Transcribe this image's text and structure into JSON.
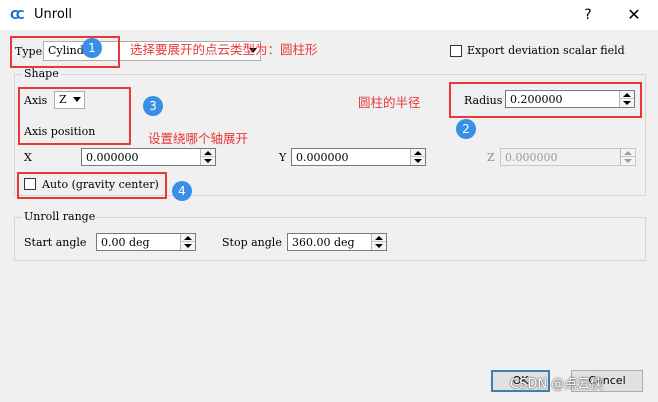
{
  "window": {
    "title": "Unroll",
    "help_glyph": "?",
    "close_glyph": "✕",
    "icon": "cloudcompare-logo-icon"
  },
  "type_row": {
    "label": "Type",
    "value": "Cylinder",
    "export_label": "Export deviation scalar field"
  },
  "shape": {
    "title": "Shape",
    "axis_label": "Axis",
    "axis_value": "Z",
    "axis_position_label": "Axis position",
    "radius_label": "Radius",
    "radius_value": "0.200000",
    "x_label": "X",
    "x_value": "0.000000",
    "y_label": "Y",
    "y_value": "0.000000",
    "z_label": "Z",
    "z_value": "0.000000",
    "auto_label": "Auto (gravity center)"
  },
  "unroll_range": {
    "title": "Unroll range",
    "start_label": "Start angle",
    "start_value": "0.00 deg",
    "stop_label": "Stop angle",
    "stop_value": "360.00 deg"
  },
  "buttons": {
    "ok": "OK",
    "cancel": "Cancel"
  },
  "annotations": {
    "a1_text": "选择要展开的点云类型为：圆柱形",
    "a2_text": "圆柱的半径",
    "a3_text": "设置绕哪个轴展开",
    "badge1": "1",
    "badge2": "2",
    "badge3": "3",
    "badge4": "4",
    "color": "#e8383a",
    "badge_color": "#3a8ee6"
  },
  "watermark": "CSDN @点云侠"
}
